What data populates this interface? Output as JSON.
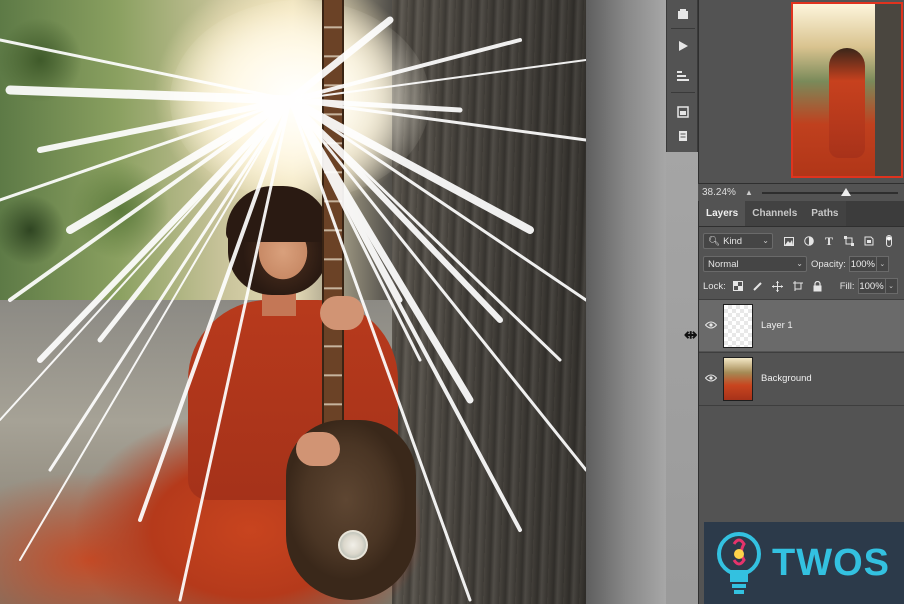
{
  "app": "Adobe Photoshop",
  "canvas": {
    "description_icon": "photo-canvas"
  },
  "toolstrip": {
    "icons": [
      "history-icon",
      "play-actions-icon",
      "adjustments-icon",
      "libraries-icon",
      "notes-icon"
    ]
  },
  "navigator": {
    "zoom_value": "38.24%"
  },
  "layers_panel": {
    "tabs": [
      {
        "label": "Layers",
        "active": true
      },
      {
        "label": "Channels",
        "active": false
      },
      {
        "label": "Paths",
        "active": false
      }
    ],
    "filter": {
      "kind_label": "Kind",
      "icons": [
        "image-filter-icon",
        "adjustment-filter-icon",
        "type-filter-icon",
        "shape-filter-icon",
        "smart-object-filter-icon",
        "filter-toggle-icon"
      ]
    },
    "blend_mode": "Normal",
    "opacity_label": "Opacity:",
    "opacity_value": "100%",
    "lock_label": "Lock:",
    "lock_icons": [
      "lock-transparent-icon",
      "lock-image-icon",
      "lock-position-icon",
      "lock-artboard-icon",
      "lock-all-icon"
    ],
    "fill_label": "Fill:",
    "fill_value": "100%",
    "layers": [
      {
        "name": "Layer 1",
        "selected": true,
        "visible": true,
        "thumbnail": "transparent"
      },
      {
        "name": "Background",
        "selected": false,
        "visible": true,
        "thumbnail": "photo"
      }
    ]
  },
  "watermark": {
    "text": "TWOS",
    "color": "#33c1e0",
    "background": "#2c3a4a"
  },
  "colors": {
    "panel_bg": "#535353",
    "panel_dark": "#424242",
    "selected_layer": "#6a6a6a",
    "navigator_proxy": "#e0331e"
  }
}
